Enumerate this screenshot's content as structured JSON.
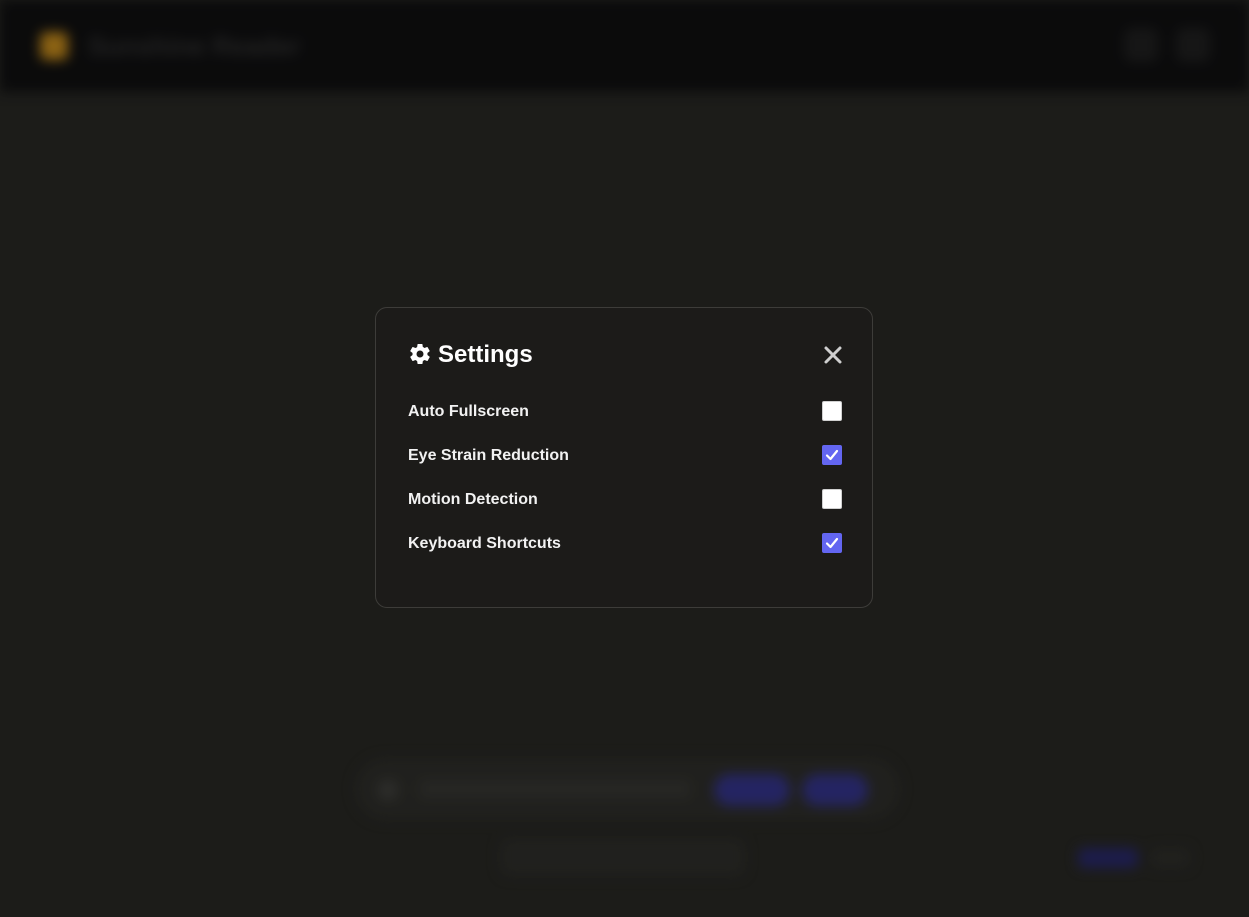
{
  "app": {
    "title": "Sunshine Reader"
  },
  "settings_modal": {
    "title": "Settings",
    "title_icon": "gear-icon",
    "close_icon": "close-icon",
    "options": [
      {
        "label": "Auto Fullscreen",
        "checked": false
      },
      {
        "label": "Eye Strain Reduction",
        "checked": true
      },
      {
        "label": "Motion Detection",
        "checked": false
      },
      {
        "label": "Keyboard Shortcuts",
        "checked": true
      }
    ]
  },
  "colors": {
    "checkbox_accent": "#6366f1",
    "modal_background": "#1c1b19",
    "page_background": "#1f1f1b",
    "brand_logo": "#c98a12"
  }
}
